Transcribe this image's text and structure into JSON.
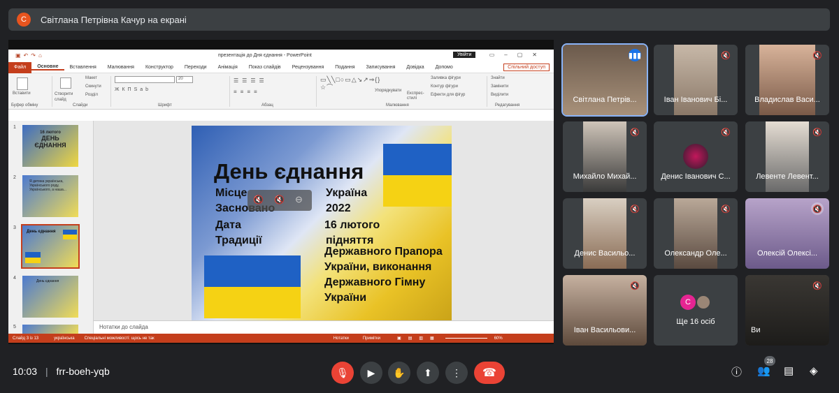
{
  "banner": {
    "avatar_letter": "С",
    "text": "Світлана Петрівна Качур на екрані"
  },
  "ppt": {
    "title": "презентація до Дня єднання - PowerPoint",
    "sign_in": "Увійти",
    "tabs": [
      "Файл",
      "Основне",
      "Вставлення",
      "Малювання",
      "Конструктор",
      "Переходи",
      "Анімація",
      "Показ слайдів",
      "Рецензування",
      "Подання",
      "Записування",
      "Довідка",
      "Допомо"
    ],
    "share": "Спільний доступ",
    "ribbon": {
      "clipboard": "Буфер обміну",
      "paste": "Вставити",
      "slides": "Слайди",
      "new_slide": "Створити слайд",
      "layout": "Макет",
      "reset": "Скинути",
      "section": "Розділ",
      "font": "Шрифт",
      "paragraph": "Абзац",
      "drawing": "Малювання",
      "arrange": "Упорядкувати",
      "quick_styles": "Експрес-стилі",
      "fill": "Заливка фігури",
      "outline": "Контур фігури",
      "effects": "Ефекти для фігур",
      "editing": "Редагування",
      "find": "Знайти",
      "replace": "Замінити",
      "select": "Виділити",
      "font_size": "20"
    },
    "thumbnails": [
      {
        "num": "1",
        "line1": "16 лютого",
        "line2": "ДЕНЬ",
        "line3": "ЄДНАННЯ"
      },
      {
        "num": "2",
        "text": "Я дитина українська, Українського роду, Українського, а наша..."
      },
      {
        "num": "3",
        "title": "День єднання"
      },
      {
        "num": "4",
        "title": "День єднання"
      },
      {
        "num": "5"
      }
    ],
    "slide": {
      "title": "День єднання",
      "left": [
        "Місце",
        "Засновано",
        "Дата",
        "Традиції"
      ],
      "right": [
        "Україна",
        "2022",
        "16 лютого",
        "підняття",
        "Державного Прапора",
        "України, виконання",
        "Державного Гімну",
        "України"
      ]
    },
    "notes": "Нотатки до слайда",
    "status": {
      "slide": "Слайд 3 із 13",
      "language": "українська",
      "accessibility": "Спеціальні можливості: щось не так",
      "notes": "Нотатки",
      "comments": "Примітки",
      "zoom": "60%"
    }
  },
  "participants": [
    {
      "name": "Світлана Петрів...",
      "state": "speaking"
    },
    {
      "name": "Іван Іванович Бі...",
      "state": "muted"
    },
    {
      "name": "Владислав Васи...",
      "state": "muted"
    },
    {
      "name": "Михайло Михай...",
      "state": "muted"
    },
    {
      "name": "Денис Іванович С...",
      "state": "muted"
    },
    {
      "name": "Левенте Левент...",
      "state": "muted"
    },
    {
      "name": "Денис Васильо...",
      "state": "muted"
    },
    {
      "name": "Олександр Оле...",
      "state": "muted"
    },
    {
      "name": "Олексій Олексі...",
      "state": "muted"
    },
    {
      "name": "Іван Васильови...",
      "state": "muted"
    },
    {
      "name": "Ще 16 осіб",
      "avatar_letter": "С"
    },
    {
      "name": "Ви",
      "state": "muted"
    }
  ],
  "footer": {
    "time": "10:03",
    "meeting_code": "frr-boeh-yqb",
    "people_count": "28"
  },
  "colors": {
    "accent_red": "#ea4335",
    "ppt_orange": "#c43e1c",
    "speaking": "#8ab4f8"
  }
}
